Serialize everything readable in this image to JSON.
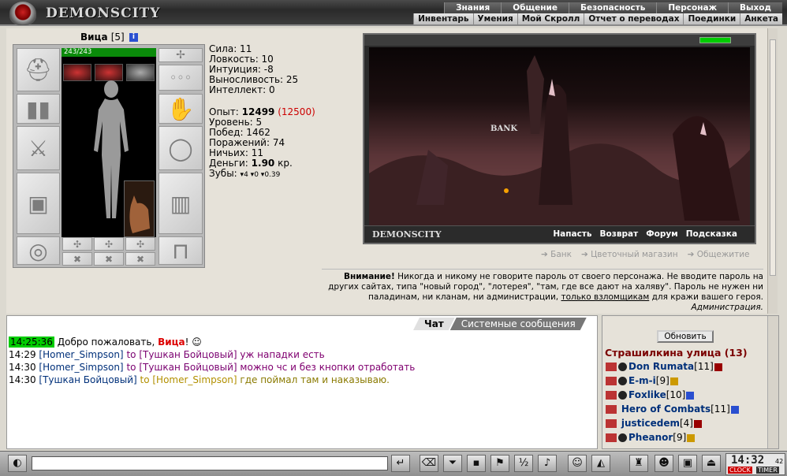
{
  "header": {
    "logo": "DEMONSCITY",
    "nav_top": [
      "Знания",
      "Общение",
      "Безопасность",
      "Персонаж",
      "Выход"
    ],
    "nav_bottom": [
      "Инвентарь",
      "Умения",
      "Мой Скролл",
      "Отчет о переводах",
      "Поединки",
      "Анкета"
    ]
  },
  "character": {
    "name": "Вица",
    "level": "[5]",
    "hp": "243/243"
  },
  "stats": {
    "strength": "Сила: 11",
    "agility": "Ловкость: 10",
    "intuition": "Интуиция: -8",
    "endurance": "Выносливость: 25",
    "intellect": "Интеллект: 0",
    "exp_label": "Опыт:",
    "exp_value": "12499",
    "exp_next": "(12500)",
    "level": "Уровень: 5",
    "wins": "Побед: 1462",
    "losses": "Поражений: 74",
    "draws": "Ничьих: 11",
    "money_label": "Деньги:",
    "money_value": "1.90",
    "money_unit": "кр.",
    "teeth_label": "Зубы:",
    "teeth": [
      "4",
      "0",
      "0.39"
    ]
  },
  "game": {
    "scene_label": "BANK",
    "logo": "DEMONSCITY",
    "links": [
      "Напасть",
      "Возврат",
      "Форум",
      "Подсказка"
    ],
    "quick_links": [
      "Банк",
      "Цветочный магазин",
      "Общежитие"
    ]
  },
  "warning": {
    "bold": "Внимание!",
    "line1": " Никогда и никому не говорите пароль от своего персонажа. Не вводите пароль на",
    "line2": "других сайтах, типа \"новый город\", \"лотерея\", \"там, где все дают на халяву\". Пароль не нужен ни",
    "line3a": "паладинам, ни кланам, ни администрации, ",
    "line3u": "только взломщикам",
    "line3b": " для кражи вашего героя.",
    "signature": "Администрация."
  },
  "chat": {
    "tabs": [
      "Чат",
      "Системные сообщения"
    ],
    "messages": [
      {
        "time": "14:25:36",
        "pre": "Добро пожаловать, ",
        "name": "Вица",
        "post": "!"
      },
      {
        "time": "14:29",
        "from": "[Homer_Simpson]",
        "to": "to [Тушкан Бойцовый]",
        "text": "уж нападки есть"
      },
      {
        "time": "14:30",
        "from": "[Homer_Simpson]",
        "to": "to [Тушкан Бойцовый]",
        "text": "можно чс и без кнопки отработать"
      },
      {
        "time": "14:30",
        "from": "[Тушкан Бойцовый]",
        "to": "to [Homer_Simpson]",
        "text": "где поймал там и наказываю."
      }
    ]
  },
  "side": {
    "refresh": "Обновить",
    "location": "Страшилкина улица (13)",
    "users": [
      {
        "name": "Don Rumata",
        "level": "[11]",
        "info": "red"
      },
      {
        "name": "E-m-i",
        "level": "[9]",
        "info": "yellow"
      },
      {
        "name": "Foxlike",
        "level": "[10]",
        "info": "blue"
      },
      {
        "name": "Hero of Combats",
        "level": "[11]",
        "info": "blue"
      },
      {
        "name": "justicedem",
        "level": "[4]",
        "info": "red"
      },
      {
        "name": "Pheanor",
        "level": "[9]",
        "info": "yellow"
      }
    ]
  },
  "clock": {
    "time": "14:32",
    "seconds": "42",
    "label1": "CLOCK",
    "label2": "TIMER"
  }
}
